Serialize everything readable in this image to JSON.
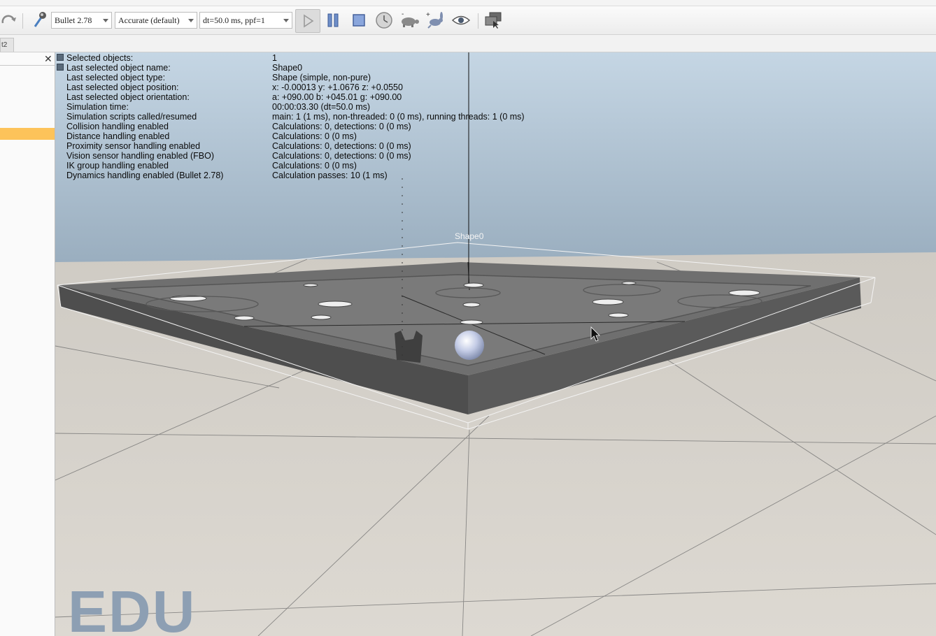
{
  "toolbar": {
    "physics_engine": "Bullet 2.78",
    "accuracy": "Accurate (default)",
    "time_step": "dt=50.0 ms, ppf=1"
  },
  "tabs": {
    "partial_tab": "t2"
  },
  "info_panel": {
    "rows": [
      {
        "label": "Selected objects:",
        "value": "1"
      },
      {
        "label": "Last selected object name:",
        "value": "Shape0"
      },
      {
        "label": "Last selected object type:",
        "value": "Shape (simple, non-pure)"
      },
      {
        "label": "Last selected object position:",
        "value": "x: -0.00013    y: +1.0676    z: +0.0550"
      },
      {
        "label": "Last selected object orientation:",
        "value": "a: +090.00    b: +045.01    g: +090.00"
      },
      {
        "label": "Simulation time:",
        "value": "00:00:03.30 (dt=50.0 ms)"
      },
      {
        "label": "Simulation scripts called/resumed",
        "value": "main: 1 (1 ms), non-threaded: 0 (0 ms), running threads: 1 (0 ms)"
      },
      {
        "label": "Collision handling enabled",
        "value": "Calculations: 0, detections: 0 (0 ms)"
      },
      {
        "label": "Distance handling enabled",
        "value": "Calculations: 0 (0 ms)"
      },
      {
        "label": "Proximity sensor handling enabled",
        "value": "Calculations: 0, detections: 0 (0 ms)"
      },
      {
        "label": "Vision sensor handling enabled (FBO)",
        "value": "Calculations: 0, detections: 0 (0 ms)"
      },
      {
        "label": "IK group handling enabled",
        "value": "Calculations: 0 (0 ms)"
      },
      {
        "label": "Dynamics handling enabled (Bullet 2.78)",
        "value": "Calculation passes: 10 (1 ms)"
      }
    ]
  },
  "scene": {
    "object_label": "Shape0",
    "watermark": "EDU"
  },
  "colors": {
    "selection_highlight": "#fdc35a",
    "sky": "#b9cede",
    "platform": "#5a5a5a"
  }
}
